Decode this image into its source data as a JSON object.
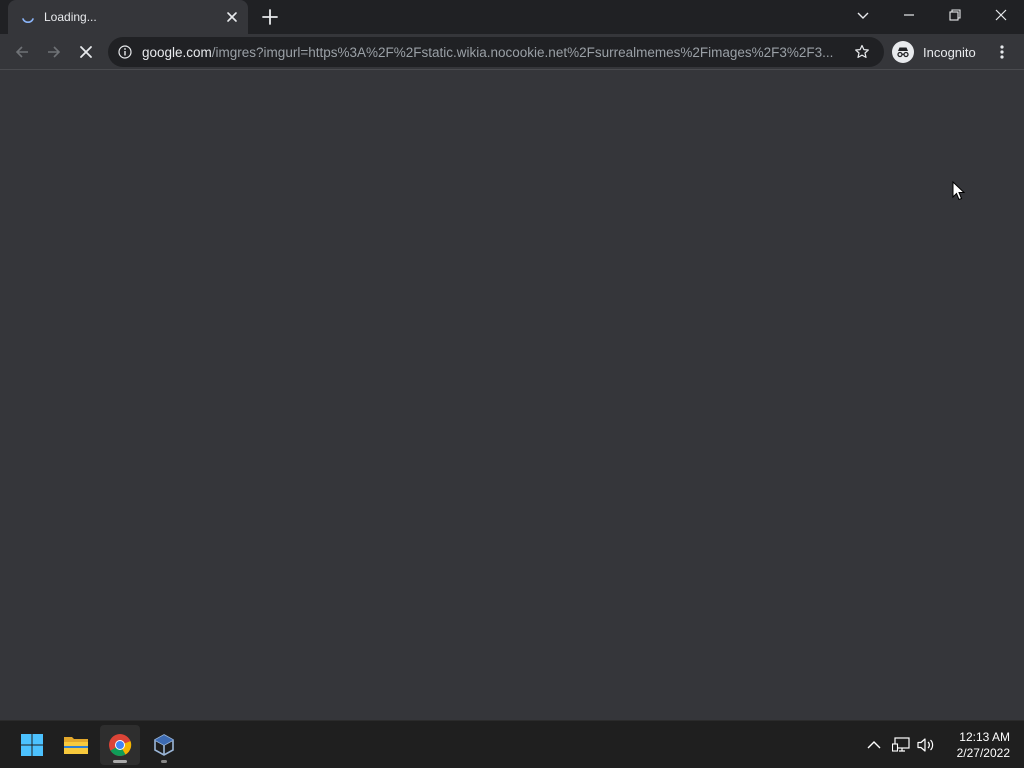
{
  "browser": {
    "tab": {
      "title": "Loading...",
      "loading_icon": "spinner-icon",
      "close_icon": "close-icon"
    },
    "new_tab_icon": "plus-icon",
    "window_controls": [
      "tab-search-icon",
      "minimize-icon",
      "restore-icon",
      "close-icon"
    ],
    "toolbar": {
      "back_icon": "arrow-left-icon",
      "forward_icon": "arrow-right-icon",
      "stop_icon": "stop-icon",
      "address": {
        "host": "google.com",
        "path": "/imgres?imgurl=https%3A%2F%2Fstatic.wikia.nocookie.net%2Fsurrealmemes%2Fimages%2F3%2F3..."
      },
      "star_icon": "star-icon",
      "incognito_label": "Incognito",
      "menu_icon": "kebab-menu-icon"
    }
  },
  "taskbar": {
    "apps": [
      "windows-start",
      "file-explorer",
      "google-chrome",
      "virtualbox"
    ],
    "tray_icons": [
      "chevron-up-icon",
      "network-icon",
      "volume-icon"
    ],
    "clock": {
      "time": "12:13 AM",
      "date": "2/27/2022"
    }
  },
  "colors": {
    "tabstrip": "#202124",
    "content": "#35363a",
    "omnibox": "#202124",
    "taskbar": "#1f1f1f",
    "text": "#e8eaed",
    "muted": "#9aa0a6"
  }
}
